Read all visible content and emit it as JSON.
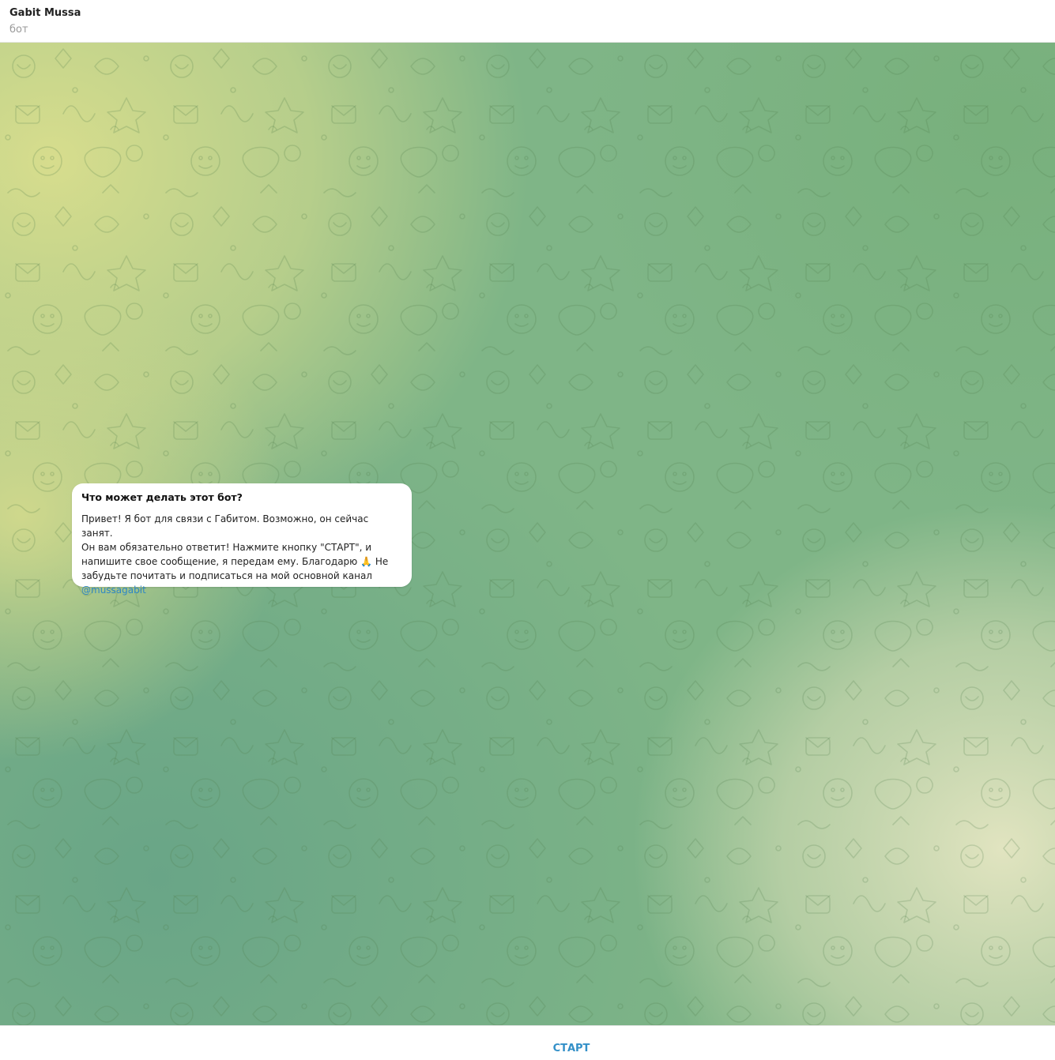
{
  "header": {
    "title": "Gabit Mussa",
    "subtitle": "бот"
  },
  "bot_info": {
    "title": "Что может делать этот бот?",
    "description": "Привет! Я бот для связи с Габитом. Возможно, он сейчас занят.\nОн вам обязательно ответит! Нажмите кнопку \"СТАРТ\", и\nнапишите свое сообщение, я передам ему. Благодарю 🙏 Не\nзабудьте почитать и подписаться на мой основной канал",
    "link": "@mussagabit"
  },
  "footer": {
    "start_label": "СТАРТ"
  },
  "colors": {
    "link": "#2e86c6",
    "start_button": "#3390c8",
    "bg_yellow": "#d4dc8c",
    "bg_green": "#6fa886",
    "bg_cream": "#dde2bc"
  }
}
